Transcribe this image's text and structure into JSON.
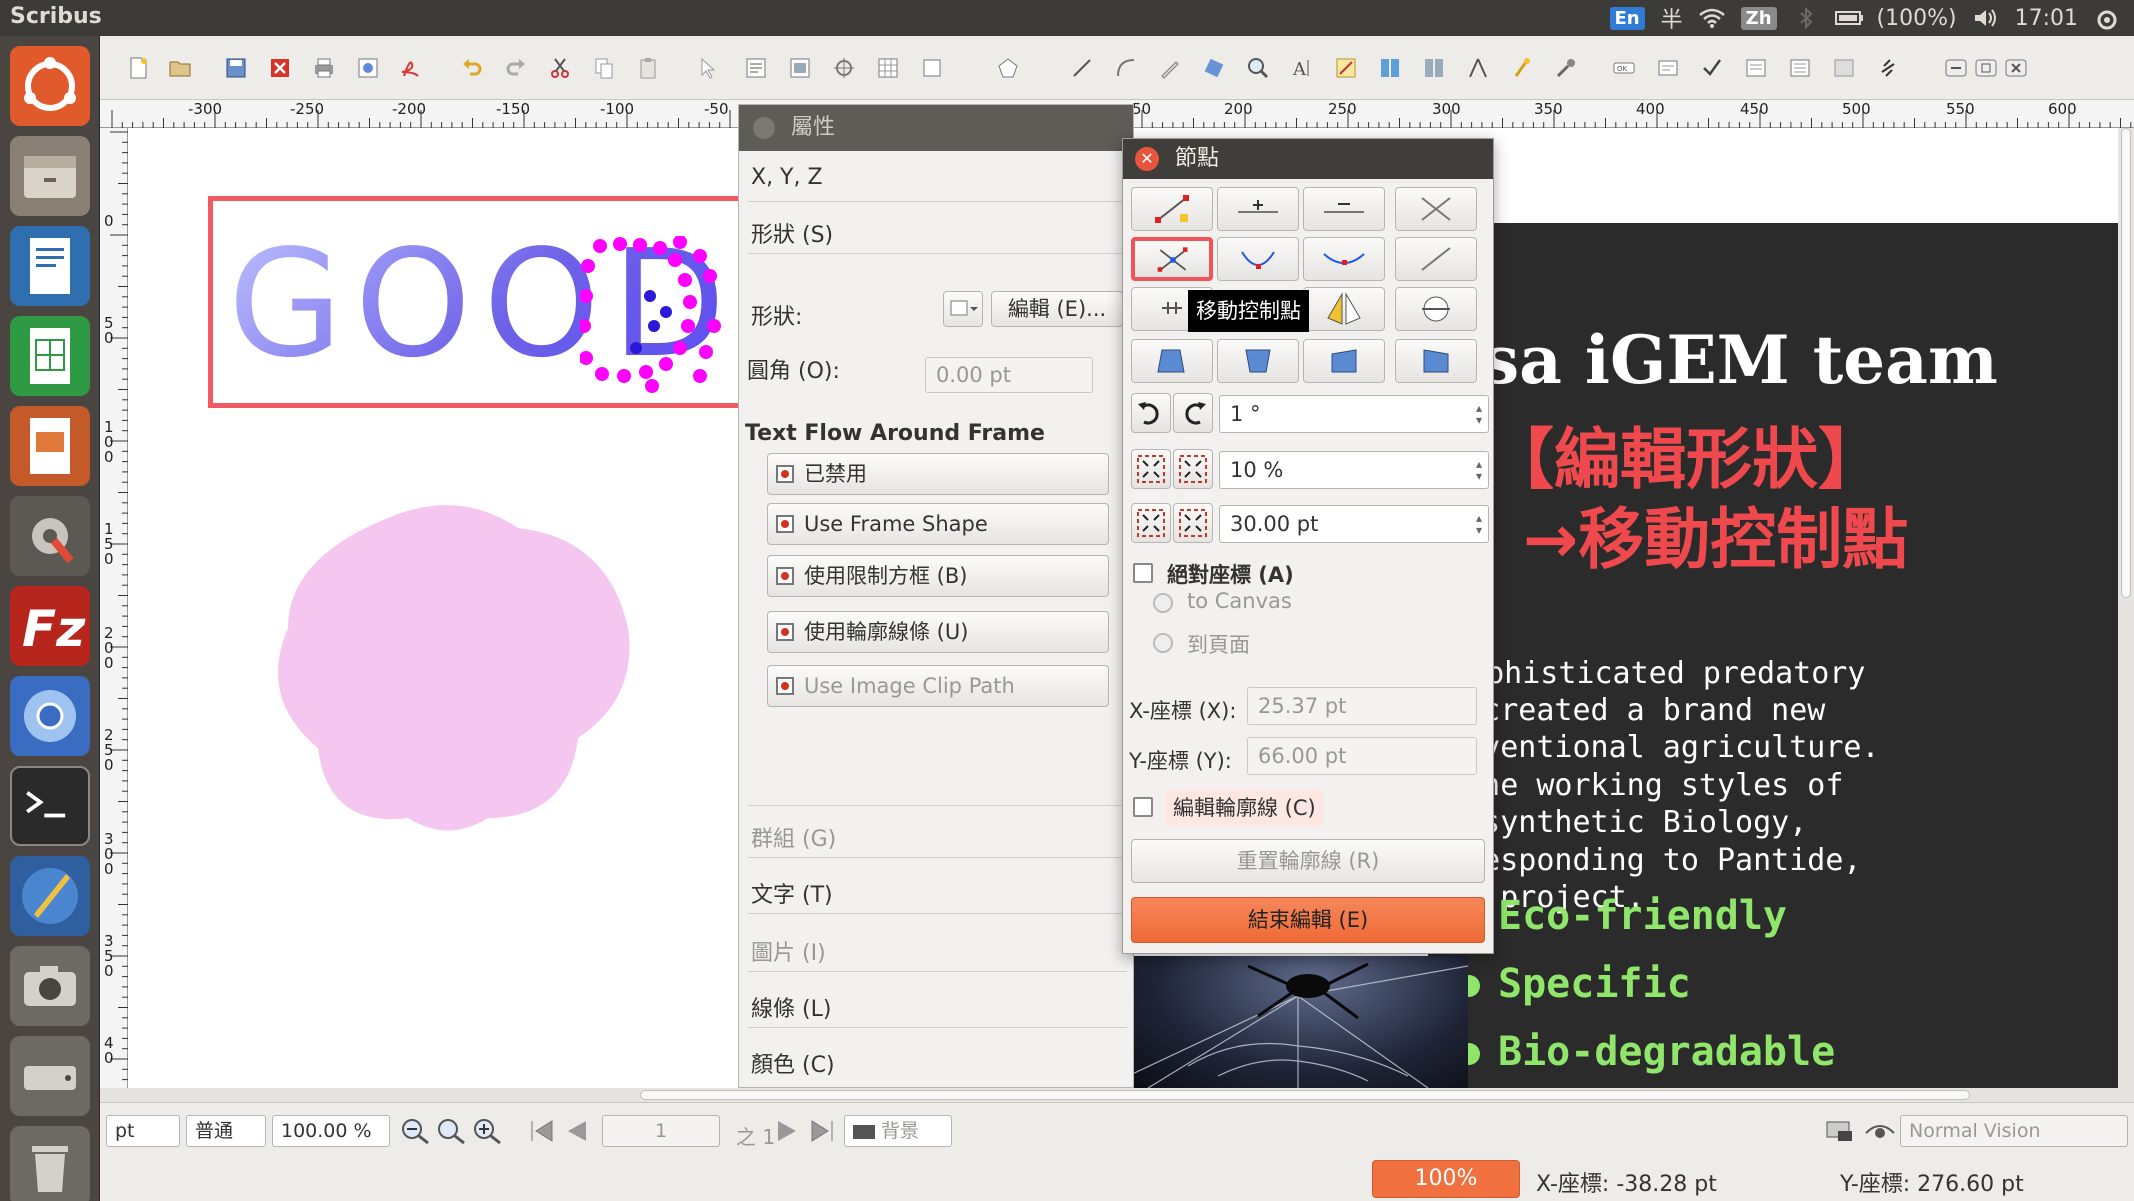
{
  "app": {
    "name": "Scribus"
  },
  "tray": {
    "lang_en": "En",
    "ime": "半",
    "lang_zh": "Zh",
    "battery": "(100%)",
    "time": "17:01"
  },
  "ruler": {
    "h_labels": [
      "-300",
      "-250",
      "-200",
      "-150",
      "-100",
      "-50",
      "50",
      "200",
      "250",
      "300",
      "350",
      "400",
      "450",
      "500",
      "550",
      "600"
    ],
    "v_labels": [
      "0",
      "5\n0",
      "1\n0\n0",
      "1\n5\n0",
      "2\n0\n0",
      "2\n5\n0",
      "3\n0\n0",
      "3\n5\n0",
      "4\n0"
    ]
  },
  "canvas": {
    "good_text": "GOOD",
    "slide": {
      "title": "osa iGEM team",
      "red_line1": "【編輯形狀】",
      "red_line2": "→移動控制點",
      "body": [
        "sophisticated predatory",
        "as  created  a  brand  new",
        "conventional agriculture.",
        "g  the  working  styles  of",
        " of  synthetic  Biology,",
        "orresponding  to  Pantide,",
        " our project."
      ],
      "bullets": [
        "Eco-friendly",
        "Specific",
        "Bio-degradable"
      ]
    }
  },
  "properties": {
    "title": "屬性",
    "xyz": "X, Y, Z",
    "shape_section": "形狀 (S)",
    "shape_label": "形狀:",
    "edit_button": "編輯 (E)...",
    "corner_label": "圓角 (O):",
    "corner_value": "0.00 pt",
    "text_flow": "Text Flow Around Frame",
    "flow_options": [
      "已禁用",
      "Use Frame Shape",
      "使用限制方框 (B)",
      "使用輪廓線條 (U)",
      "Use Image Clip Path"
    ],
    "sections": [
      "群組 (G)",
      "文字 (T)",
      "圖片 (I)",
      "線條 (L)",
      "顏色 (C)"
    ]
  },
  "nodes": {
    "title": "節點",
    "tooltip": "移動控制點",
    "rotate_value": "1 °",
    "scale_pct": "10 %",
    "scale_pt": "30.00 pt",
    "absolute_label": "絕對座標 (A)",
    "to_canvas": "to Canvas",
    "to_page": "到頁面",
    "x_label": "X-座標 (X):",
    "x_value": "25.37 pt",
    "y_label": "Y-座標 (Y):",
    "y_value": "66.00 pt",
    "edit_contour": "編輯輪廓線 (C)",
    "reset_contour": "重置輪廓線 (R)",
    "end_edit": "結束編輯 (E)"
  },
  "statusbar": {
    "unit": "pt",
    "mode": "普通",
    "zoom": "100.00 %",
    "page": "1",
    "of_pages": "之 1",
    "layer": "背景",
    "vision": "Normal Vision"
  },
  "bottom": {
    "progress": "100%",
    "x_coord": "X-座標: -38.28 pt",
    "y_coord": "Y-座標: 276.60 pt"
  },
  "colors": {
    "accent": "#f0703f",
    "frame_red": "#ef5a63",
    "bullet_green": "#8fe66a",
    "slide_red": "#f0494d",
    "flower_pink": "#f5c6ef"
  }
}
